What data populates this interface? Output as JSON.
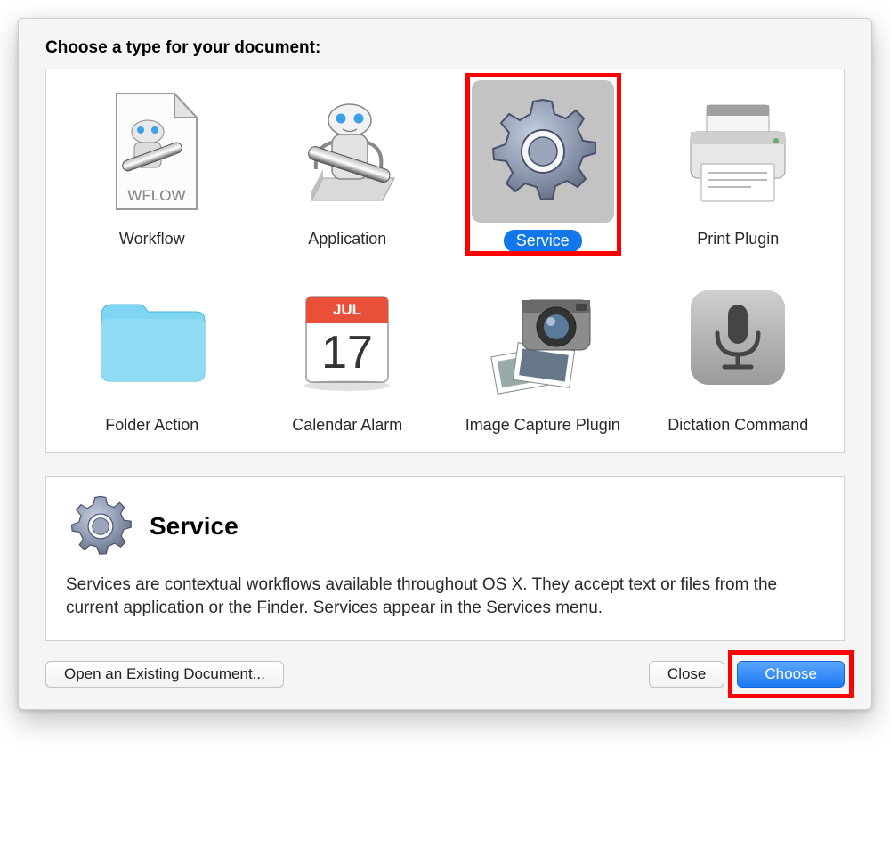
{
  "prompt": "Choose a type for your document:",
  "types": {
    "workflow": {
      "label": "Workflow"
    },
    "application": {
      "label": "Application"
    },
    "service": {
      "label": "Service"
    },
    "print_plugin": {
      "label": "Print Plugin"
    },
    "folder_action": {
      "label": "Folder Action"
    },
    "calendar_alarm": {
      "label": "Calendar Alarm",
      "month_text": "JUL",
      "day_text": "17"
    },
    "image_capture": {
      "label": "Image Capture Plugin"
    },
    "dictation": {
      "label": "Dictation Command"
    }
  },
  "selected_type": "service",
  "detail": {
    "title": "Service",
    "description": "Services are contextual workflows available throughout OS X. They accept text or files from the current application or the Finder. Services appear in the Services menu."
  },
  "buttons": {
    "open": "Open an Existing Document...",
    "close": "Close",
    "choose": "Choose"
  },
  "wflow_text": "WFLOW"
}
